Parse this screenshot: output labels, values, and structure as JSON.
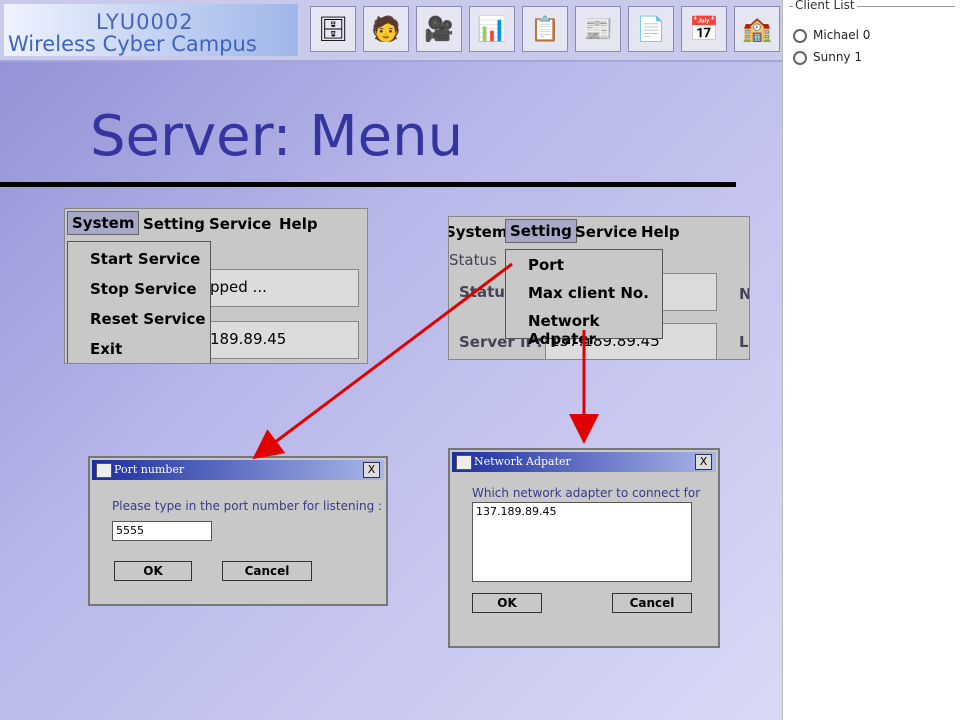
{
  "banner": {
    "line1": "LYU0002",
    "line2": "Wireless Cyber Campus",
    "tools": [
      "cabinet-icon",
      "presenter-icon",
      "camera-icon",
      "chart-icon",
      "clipboard-icon",
      "news-icon",
      "pdf-icon",
      "calendar-icon",
      "campus-icon"
    ]
  },
  "slide_title": "Server: Menu",
  "left_window": {
    "menu": [
      "System",
      "Setting",
      "Service",
      "Help"
    ],
    "dropdown": [
      "Start Service",
      "Stop Service",
      "Reset Service",
      "Exit"
    ],
    "field1": "pped ...",
    "field2": "189.89.45"
  },
  "right_window": {
    "menu": [
      "System",
      "Setting",
      "Service",
      "Help"
    ],
    "group_label": "Status",
    "status_label": "Status",
    "ip_label": "Server IP:",
    "ip_value": "137.189.89.45",
    "n_label": "N",
    "l_label": "L",
    "dropdown": [
      "Port",
      "Max client No.",
      "Network Adpater"
    ]
  },
  "port_dialog": {
    "title": "Port number",
    "close": "X",
    "prompt": "Please type in the port number for listening :",
    "value": "5555",
    "ok": "OK",
    "cancel": "Cancel"
  },
  "net_dialog": {
    "title": "Network Adpater",
    "close": "X",
    "prompt": "Which network adapter to connect for",
    "value": "137.189.89.45",
    "ok": "OK",
    "cancel": "Cancel"
  },
  "client_list": {
    "title": "Client List",
    "items": [
      "Michael 0",
      "Sunny 1"
    ]
  },
  "colors": {
    "arrow": "#e00000",
    "title": "#3535a0"
  }
}
